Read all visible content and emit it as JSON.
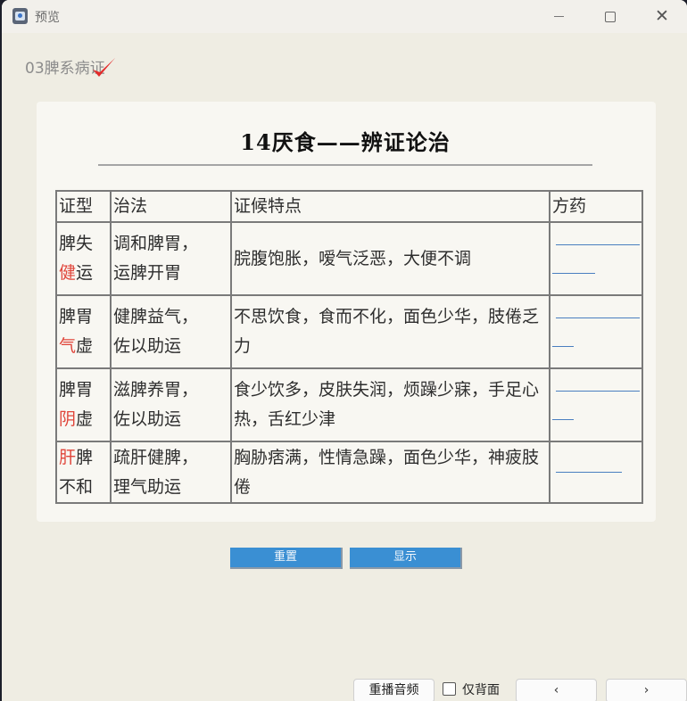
{
  "window": {
    "title": "预览",
    "icon": "preview-app-icon",
    "controls": [
      "minimize-icon",
      "maximize-icon",
      "close-icon"
    ]
  },
  "deck": {
    "label": "03脾系病证",
    "check_color": "#e32b2b"
  },
  "card": {
    "title": "14厌食——辨证论治",
    "headers": [
      "证型",
      "治法",
      "证候特点",
      "方药"
    ],
    "rows": [
      {
        "type_pre": "脾失",
        "type_red": "健",
        "type_post": "运",
        "type_line2": "",
        "method": [
          "调和脾胃，",
          "运脾开胃"
        ],
        "symptoms": "脘腹饱胀，嗳气泛恶，大便不调"
      },
      {
        "type_pre": "脾胃",
        "type_red": "气",
        "type_post": "虚",
        "type_line2": "",
        "method": [
          "健脾益气，",
          "佐以助运"
        ],
        "symptoms": "不思饮食，食而不化，面色少华，肢倦乏力"
      },
      {
        "type_pre": "脾胃",
        "type_red": "阴",
        "type_post": "虚",
        "type_line2": "",
        "method": [
          "滋脾养胃，",
          "佐以助运"
        ],
        "symptoms": "食少饮多，皮肤失润，烦躁少寐，手足心热，舌红少津"
      },
      {
        "type_pre": "",
        "type_red": "肝",
        "type_post": "脾",
        "type_line2": "不和",
        "method": [
          "疏肝健脾，",
          "理气助运"
        ],
        "symptoms": "胸胁痞满，性情急躁，面色少华，神疲肢倦"
      }
    ]
  },
  "buttons": {
    "reset": "重置",
    "show": "显示"
  },
  "footer": {
    "replay": "重播音频",
    "back_only": "仅背面",
    "prev": "‹",
    "next": "›"
  },
  "colors": {
    "accent": "#3a8fd3",
    "highlight_red": "#e0453a"
  }
}
